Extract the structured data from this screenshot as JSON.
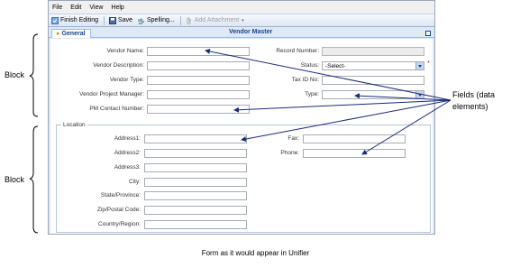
{
  "menubar": {
    "items": [
      "File",
      "Edit",
      "View",
      "Help"
    ]
  },
  "toolbar": {
    "finish_editing": "Finish Editing",
    "save": "Save",
    "spelling": "Spelling...",
    "add_attachment": "Add Attachment"
  },
  "tab": {
    "label": "General"
  },
  "form": {
    "title": "Vendor Master",
    "vendor_name_label": "Vendor Name:",
    "vendor_description_label": "Vendor Description:",
    "vendor_type_label": "Vendor Type:",
    "vendor_project_manager_label": "Vendor Project Manager:",
    "pm_contact_number_label": "PM Contact Number:",
    "record_number_label": "Record Number:",
    "status_label": "Status:",
    "status_value": "-Select-",
    "tax_id_label": "Tax ID No:",
    "type_label": "Type:",
    "location_legend": "Location",
    "address1_label": "Address1:",
    "address2_label": "Address2:",
    "address3_label": "Address3:",
    "city_label": "City:",
    "state_label": "State/Province:",
    "zip_label": "Zip/Postal Code:",
    "country_label": "Country/Region:",
    "fax_label": "Fax:",
    "phone_label": "Phone:",
    "required_mark": "*"
  },
  "annotations": {
    "block_top": "Block",
    "block_bottom": "Block",
    "fields_line1": "Fields (data",
    "fields_line2": "elements)",
    "caption": "Form as it would appear in Unifier"
  },
  "colors": {
    "accent": "#15428b",
    "window_bg": "#dfe8f6",
    "required": "#dd0000"
  }
}
